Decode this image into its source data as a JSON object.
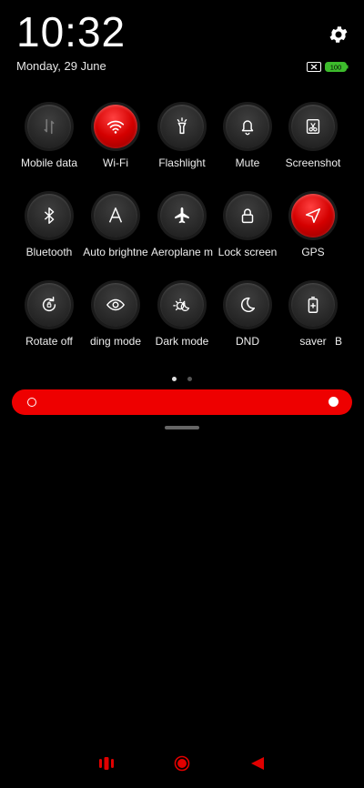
{
  "status": {
    "time": "10:32",
    "date": "Monday, 29 June",
    "battery_level": "100"
  },
  "colors": {
    "accent": "#ee0000",
    "tile_bg": "#2a2a2a",
    "background": "#000000"
  },
  "tiles": [
    {
      "label": "Mobile data",
      "icon": "mobile-data-icon",
      "active": false
    },
    {
      "label": "Wi-Fi",
      "icon": "wifi-icon",
      "active": true
    },
    {
      "label": "Flashlight",
      "icon": "flashlight-icon",
      "active": false
    },
    {
      "label": "Mute",
      "icon": "bell-icon",
      "active": false
    },
    {
      "label": "Screenshot",
      "icon": "screenshot-icon",
      "active": false
    },
    {
      "label": "Bluetooth",
      "icon": "bluetooth-icon",
      "active": false
    },
    {
      "label": "Auto brightne",
      "icon": "auto-brightness-icon",
      "active": false
    },
    {
      "label": "Aeroplane m",
      "icon": "airplane-icon",
      "active": false
    },
    {
      "label": "Lock screen",
      "icon": "lock-icon",
      "active": false
    },
    {
      "label": "GPS",
      "icon": "location-icon",
      "active": true
    },
    {
      "label": "Rotate off",
      "icon": "rotate-icon",
      "active": false
    },
    {
      "label": "ding mode",
      "icon": "eye-icon",
      "active": false
    },
    {
      "label": "Dark mode",
      "icon": "dark-mode-icon",
      "active": false
    },
    {
      "label": "DND",
      "icon": "moon-icon",
      "active": false
    },
    {
      "label": "saver",
      "icon": "battery-saver-icon",
      "active": false
    },
    {
      "label": "B",
      "icon": "",
      "active": false
    }
  ],
  "pager": {
    "pages": 2,
    "current": 1
  },
  "brightness": {
    "level": 1.0
  },
  "navbar": {
    "icons": [
      "recents-icon",
      "home-icon",
      "back-icon"
    ]
  }
}
